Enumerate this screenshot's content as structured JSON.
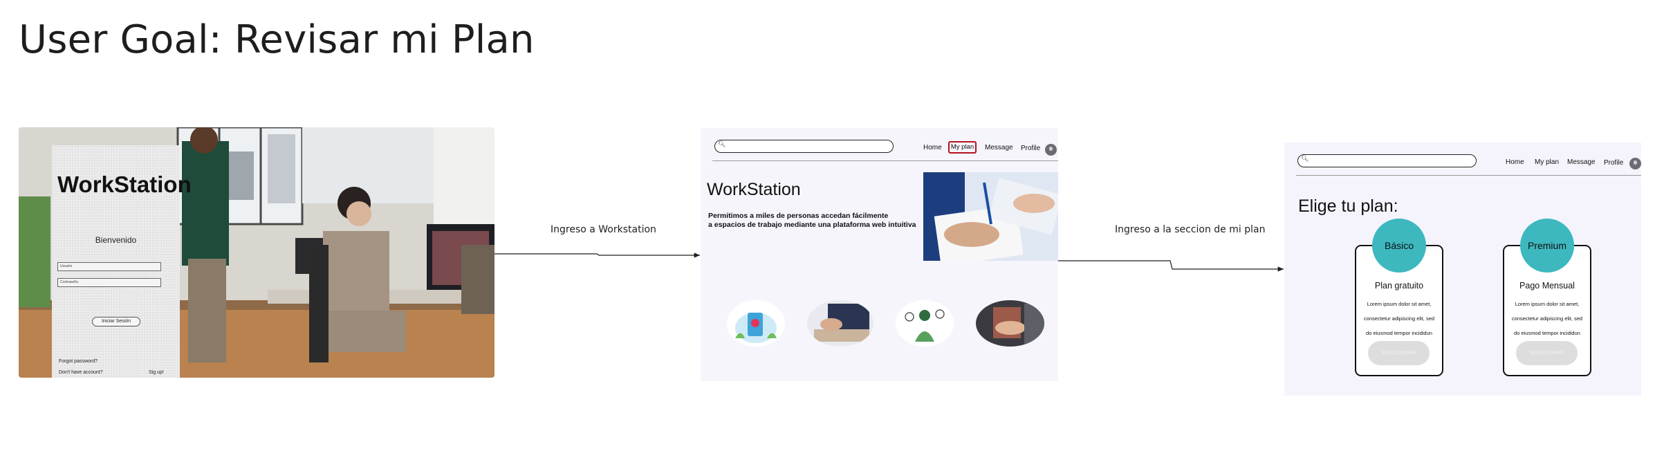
{
  "title": "User Goal: Revisar mi Plan",
  "connectors": [
    {
      "label": "Ingreso a Workstation"
    },
    {
      "label": "Ingreso a la seccion de mi plan"
    }
  ],
  "login": {
    "brand": "WorkStation",
    "welcome": "Bienvenido",
    "user_placeholder": "Usuario",
    "pass_placeholder": "Contraseña",
    "login_button": "Iniciar Sesión",
    "forgot": "Forgot password?",
    "no_account": "Don't have account?",
    "signup": "Sig up!"
  },
  "home": {
    "nav": [
      "Home",
      "My plan",
      "Message",
      "Profile"
    ],
    "highlighted_nav": "My plan",
    "highlight_color": "#b3121e",
    "brand": "WorkStation",
    "tagline_1": "Permitimos a miles de personas accedan fácilmente",
    "tagline_2": "a espacios de trabajo mediante una plataforma web intuitiva"
  },
  "plans": {
    "nav": [
      "Home",
      "My plan",
      "Message",
      "Profile"
    ],
    "heading": "Elige tu plan:",
    "accent": "#3db8bf",
    "cards": [
      {
        "badge": "Básico",
        "name": "Plan gratuito",
        "desc_1": "Lorem ipsum dolor sit amet,",
        "desc_2": "consectetur adipiscing elit, sed",
        "desc_3": "do eiusmod tempor incididun",
        "button": "SELECCIONAR"
      },
      {
        "badge": "Premium",
        "name": "Pago Mensual",
        "desc_1": "Lorem ipsum dolor sit amet,",
        "desc_2": "consectetur adipiscing elit, sed",
        "desc_3": "do eiusmod tempor incididun",
        "button": "SELECCIONAR"
      }
    ]
  }
}
